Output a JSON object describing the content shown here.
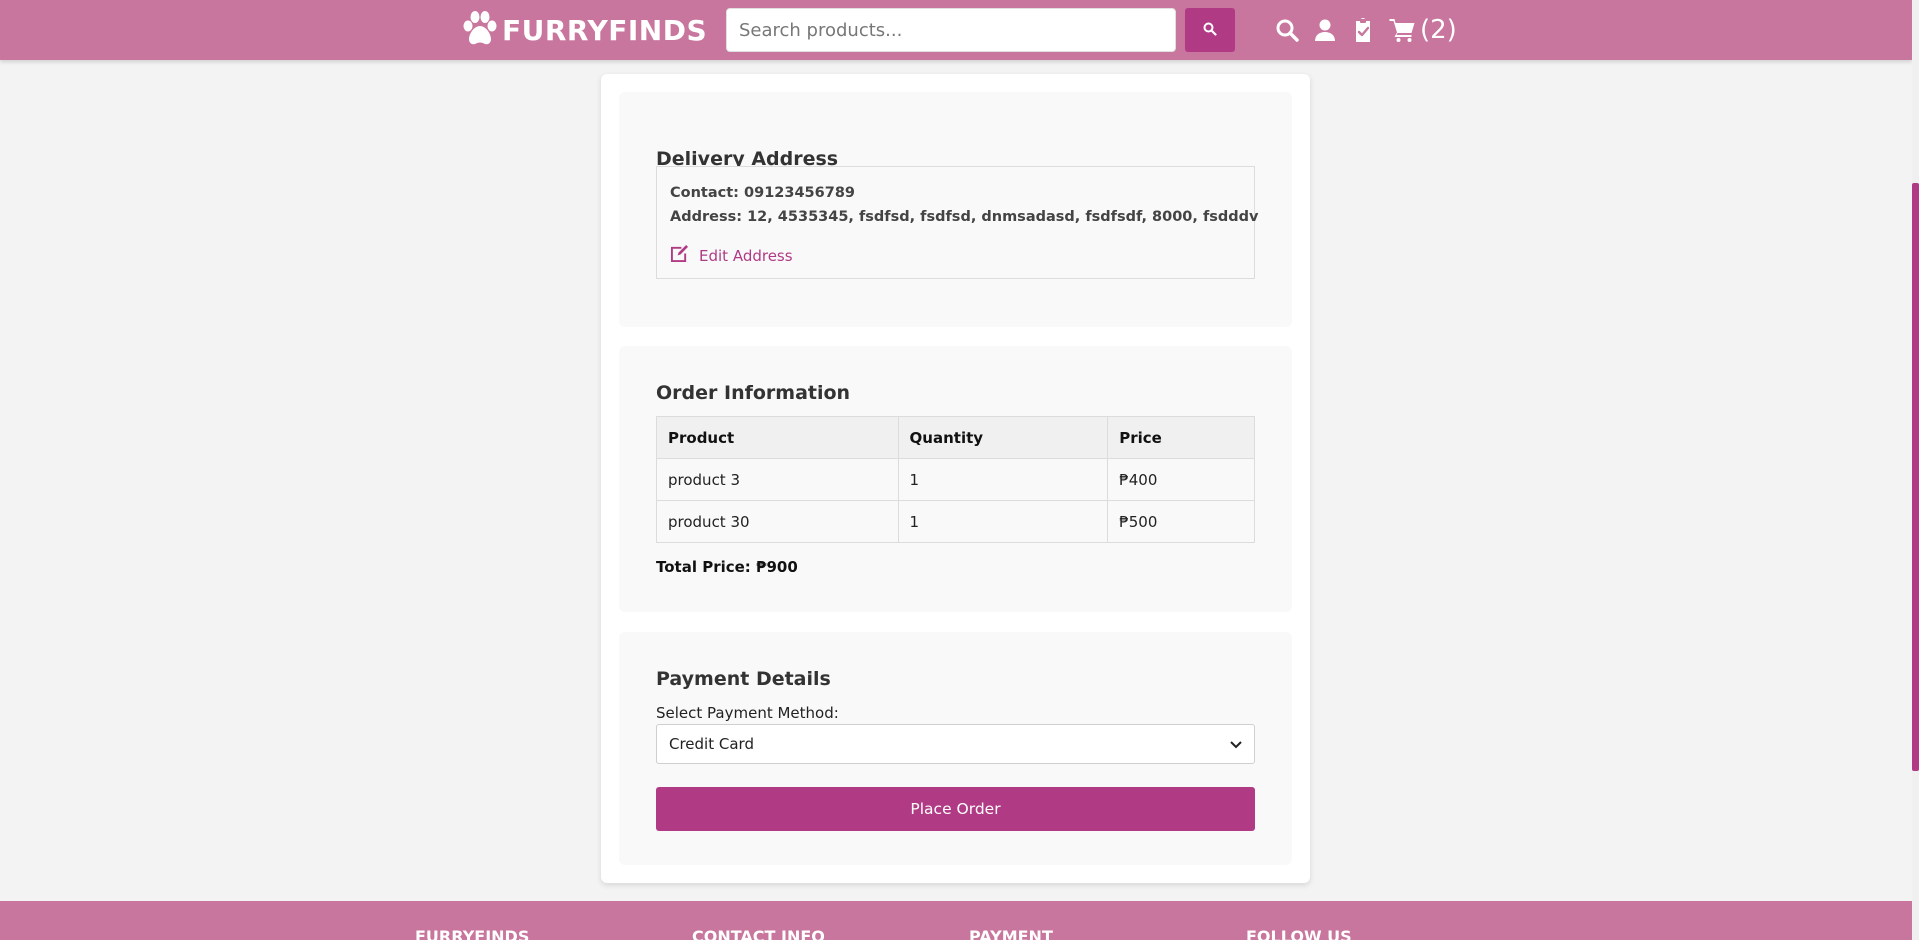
{
  "header": {
    "logo_text": "FURRYFINDS",
    "search_placeholder": "Search products...",
    "cart_count": "(2)",
    "icons": [
      "paw-icon",
      "search-icon",
      "user-icon",
      "orders-clipboard-icon",
      "cart-icon"
    ]
  },
  "delivery": {
    "title": "Delivery Address",
    "contact": "Contact: 09123456789",
    "address": "Address: 12, 4535345, fsdfsd, fsdfsd, dnmsadasd, fsdfsdf, 8000, fsdddv",
    "edit_label": "Edit Address"
  },
  "order": {
    "title": "Order Information",
    "columns": [
      "Product",
      "Quantity",
      "Price"
    ],
    "rows": [
      [
        "product 3",
        "1",
        "₱400"
      ],
      [
        "product 30",
        "1",
        "₱500"
      ]
    ],
    "total": "Total Price: ₱900"
  },
  "payment": {
    "title": "Payment Details",
    "method_label": "Select Payment Method:",
    "selected_method": "Credit Card",
    "place_order_label": "Place Order"
  },
  "footer": {
    "headings": [
      "FURRYFINDS",
      "CONTACT INFO",
      "PAYMENT",
      "FOLLOW US"
    ]
  },
  "colors": {
    "header_bg": "#c8769d",
    "accent": "#b13a85",
    "page_bg": "#f3f3f3"
  }
}
